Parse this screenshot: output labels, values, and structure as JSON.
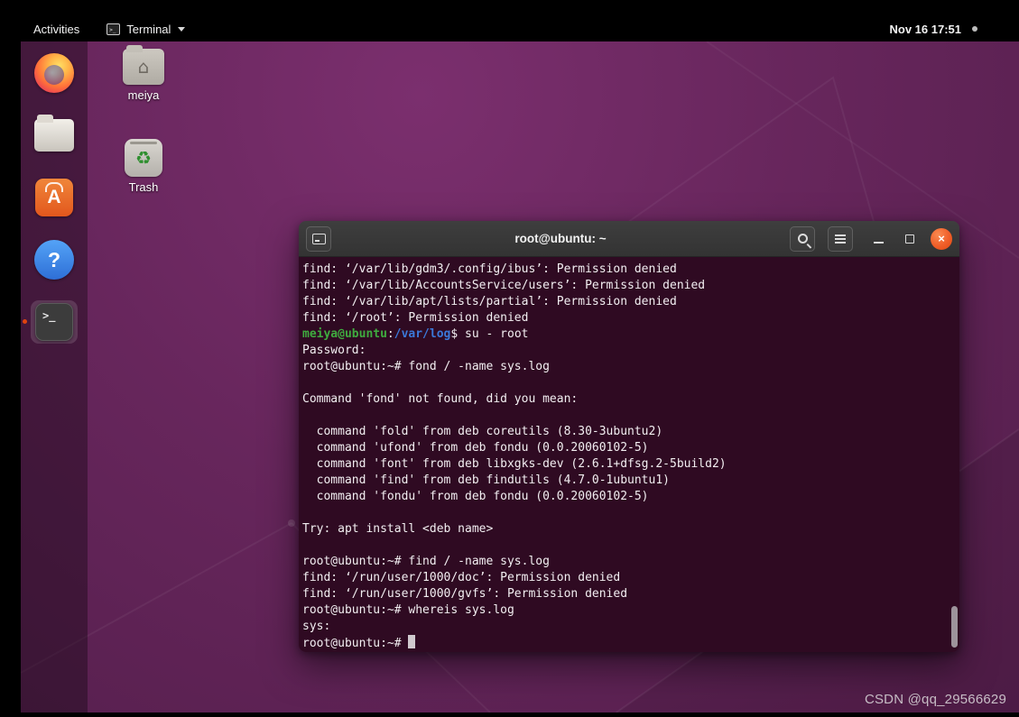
{
  "palette": {
    "accent-orange": "#e95420",
    "terminal-bg": "#2f0a22",
    "terminal-fg": "#f2eef1",
    "prompt-green": "#3fab3f",
    "path-blue": "#3b78d8"
  },
  "top_bar": {
    "activities_label": "Activities",
    "app_menu_label": "Terminal",
    "clock": "Nov 16 17:51"
  },
  "icons": {
    "terminal_glyph": ">_",
    "ubuntu_software_glyph": "A",
    "help_glyph": "?",
    "house_glyph": "⌂",
    "recycle_glyph": "♻",
    "close_glyph": "×",
    "app_menu_glyph": ">_"
  },
  "desktop": {
    "icons": [
      {
        "label": "meiya"
      },
      {
        "label": "Trash"
      }
    ],
    "watermark": "CSDN @qq_29566629"
  },
  "terminal": {
    "title": "root@ubuntu: ~",
    "lines": [
      {
        "segments": [
          {
            "text": "find: ‘/var/lib/gdm3/.config/ibus’: Permission denied"
          }
        ]
      },
      {
        "segments": [
          {
            "text": "find: ‘/var/lib/AccountsService/users’: Permission denied"
          }
        ]
      },
      {
        "segments": [
          {
            "text": "find: ‘/var/lib/apt/lists/partial’: Permission denied"
          }
        ]
      },
      {
        "segments": [
          {
            "text": "find: ‘/root’: Permission denied"
          }
        ]
      },
      {
        "segments": [
          {
            "text": "meiya@ubuntu",
            "color": "green"
          },
          {
            "text": ":"
          },
          {
            "text": "/var/log",
            "color": "blue"
          },
          {
            "text": "$ su - root"
          }
        ]
      },
      {
        "segments": [
          {
            "text": "Password: "
          }
        ]
      },
      {
        "segments": [
          {
            "text": "root@ubuntu:~# fond / -name sys.log"
          }
        ]
      },
      {
        "segments": [
          {
            "text": ""
          }
        ]
      },
      {
        "segments": [
          {
            "text": "Command 'fond' not found, did you mean:"
          }
        ]
      },
      {
        "segments": [
          {
            "text": ""
          }
        ]
      },
      {
        "segments": [
          {
            "text": "  command 'fold' from deb coreutils (8.30-3ubuntu2)"
          }
        ]
      },
      {
        "segments": [
          {
            "text": "  command 'ufond' from deb fondu (0.0.20060102-5)"
          }
        ]
      },
      {
        "segments": [
          {
            "text": "  command 'font' from deb libxgks-dev (2.6.1+dfsg.2-5build2)"
          }
        ]
      },
      {
        "segments": [
          {
            "text": "  command 'find' from deb findutils (4.7.0-1ubuntu1)"
          }
        ]
      },
      {
        "segments": [
          {
            "text": "  command 'fondu' from deb fondu (0.0.20060102-5)"
          }
        ]
      },
      {
        "segments": [
          {
            "text": ""
          }
        ]
      },
      {
        "segments": [
          {
            "text": "Try: apt install <deb name>"
          }
        ]
      },
      {
        "segments": [
          {
            "text": ""
          }
        ]
      },
      {
        "segments": [
          {
            "text": "root@ubuntu:~# find / -name sys.log"
          }
        ]
      },
      {
        "segments": [
          {
            "text": "find: ‘/run/user/1000/doc’: Permission denied"
          }
        ]
      },
      {
        "segments": [
          {
            "text": "find: ‘/run/user/1000/gvfs’: Permission denied"
          }
        ]
      },
      {
        "segments": [
          {
            "text": "root@ubuntu:~# whereis sys.log"
          }
        ]
      },
      {
        "segments": [
          {
            "text": "sys:"
          }
        ]
      },
      {
        "segments": [
          {
            "text": "root@ubuntu:~# "
          }
        ],
        "cursor": true
      }
    ]
  }
}
